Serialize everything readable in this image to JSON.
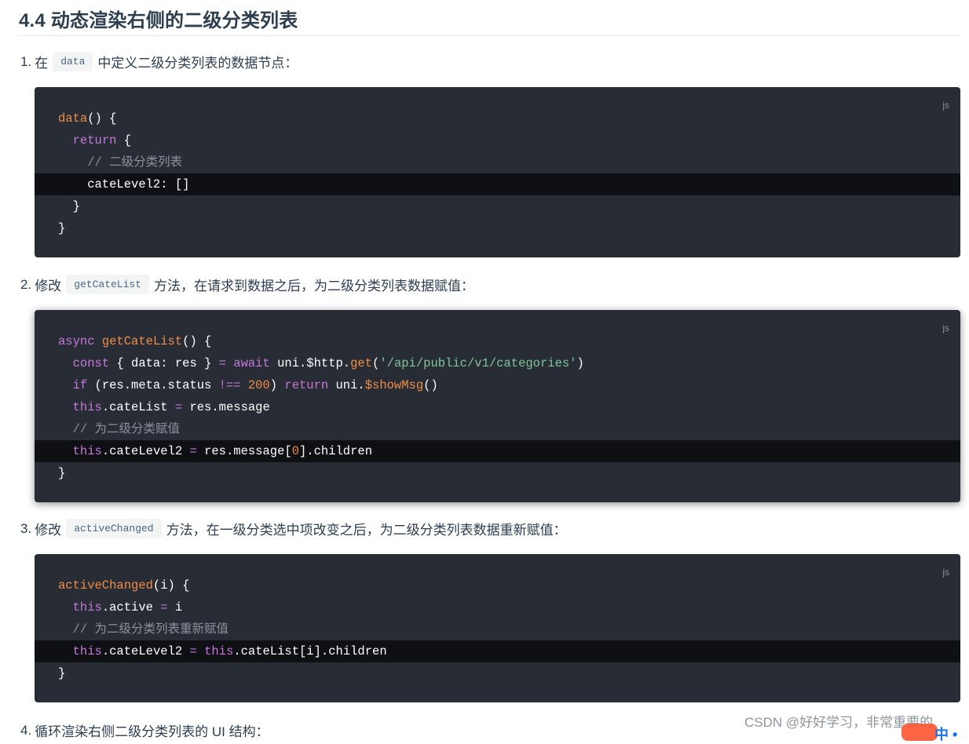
{
  "heading": "4.4 动态渲染右侧的二级分类列表",
  "steps": [
    {
      "num": "1.",
      "before": "在",
      "code": "data",
      "after": "中定义二级分类列表的数据节点："
    },
    {
      "num": "2.",
      "before": "修改",
      "code": "getCateList",
      "after": "方法，在请求到数据之后，为二级分类列表数据赋值："
    },
    {
      "num": "3.",
      "before": "修改",
      "code": "activeChanged",
      "after": "方法，在一级分类选中项改变之后，为二级分类列表数据重新赋值："
    },
    {
      "num": "4.",
      "text": "循环渲染右侧二级分类列表的 UI 结构："
    }
  ],
  "code_blocks": [
    {
      "lang": "js",
      "highlight_line": 4,
      "lines": [
        [
          {
            "t": "fn",
            "v": "data"
          },
          {
            "t": "pl",
            "v": "() {"
          }
        ],
        [
          {
            "t": "pl",
            "v": "  "
          },
          {
            "t": "kw",
            "v": "return"
          },
          {
            "t": "pl",
            "v": " {"
          }
        ],
        [
          {
            "t": "pl",
            "v": "    "
          },
          {
            "t": "cm",
            "v": "// 二级分类列表"
          }
        ],
        [
          {
            "t": "pl",
            "v": "    cateLevel2: []"
          }
        ],
        [
          {
            "t": "pl",
            "v": "  }"
          }
        ],
        [
          {
            "t": "pl",
            "v": "}"
          }
        ]
      ]
    },
    {
      "lang": "js",
      "highlight_line": 6,
      "lines": [
        [
          {
            "t": "kw",
            "v": "async"
          },
          {
            "t": "pl",
            "v": " "
          },
          {
            "t": "fn",
            "v": "getCateList"
          },
          {
            "t": "pl",
            "v": "() {"
          }
        ],
        [
          {
            "t": "pl",
            "v": "  "
          },
          {
            "t": "kw",
            "v": "const"
          },
          {
            "t": "pl",
            "v": " { data: res } "
          },
          {
            "t": "op",
            "v": "="
          },
          {
            "t": "pl",
            "v": " "
          },
          {
            "t": "kw",
            "v": "await"
          },
          {
            "t": "pl",
            "v": " uni.$http."
          },
          {
            "t": "fn",
            "v": "get"
          },
          {
            "t": "pl",
            "v": "("
          },
          {
            "t": "str",
            "v": "'/api/public/v1/categories'"
          },
          {
            "t": "pl",
            "v": ")"
          }
        ],
        [
          {
            "t": "pl",
            "v": "  "
          },
          {
            "t": "kw",
            "v": "if"
          },
          {
            "t": "pl",
            "v": " (res.meta.status "
          },
          {
            "t": "op",
            "v": "!=="
          },
          {
            "t": "pl",
            "v": " "
          },
          {
            "t": "num-t",
            "v": "200"
          },
          {
            "t": "pl",
            "v": ") "
          },
          {
            "t": "kw",
            "v": "return"
          },
          {
            "t": "pl",
            "v": " uni."
          },
          {
            "t": "fn",
            "v": "$showMsg"
          },
          {
            "t": "pl",
            "v": "()"
          }
        ],
        [
          {
            "t": "pl",
            "v": "  "
          },
          {
            "t": "kw",
            "v": "this"
          },
          {
            "t": "pl",
            "v": ".cateList "
          },
          {
            "t": "op",
            "v": "="
          },
          {
            "t": "pl",
            "v": " res.message"
          }
        ],
        [
          {
            "t": "pl",
            "v": "  "
          },
          {
            "t": "cm",
            "v": "// 为二级分类赋值"
          }
        ],
        [
          {
            "t": "pl",
            "v": "  "
          },
          {
            "t": "kw",
            "v": "this"
          },
          {
            "t": "pl",
            "v": ".cateLevel2 "
          },
          {
            "t": "op",
            "v": "="
          },
          {
            "t": "pl",
            "v": " res.message["
          },
          {
            "t": "num-t",
            "v": "0"
          },
          {
            "t": "pl",
            "v": "].children"
          }
        ],
        [
          {
            "t": "pl",
            "v": "}"
          }
        ]
      ]
    },
    {
      "lang": "js",
      "highlight_line": 4,
      "lines": [
        [
          {
            "t": "fn",
            "v": "activeChanged"
          },
          {
            "t": "pl",
            "v": "(i) {"
          }
        ],
        [
          {
            "t": "pl",
            "v": "  "
          },
          {
            "t": "kw",
            "v": "this"
          },
          {
            "t": "pl",
            "v": ".active "
          },
          {
            "t": "op",
            "v": "="
          },
          {
            "t": "pl",
            "v": " i"
          }
        ],
        [
          {
            "t": "pl",
            "v": "  "
          },
          {
            "t": "cm",
            "v": "// 为二级分类列表重新赋值"
          }
        ],
        [
          {
            "t": "pl",
            "v": "  "
          },
          {
            "t": "kw",
            "v": "this"
          },
          {
            "t": "pl",
            "v": ".cateLevel2 "
          },
          {
            "t": "op",
            "v": "="
          },
          {
            "t": "pl",
            "v": " "
          },
          {
            "t": "kw",
            "v": "this"
          },
          {
            "t": "pl",
            "v": ".cateList[i].children"
          }
        ],
        [
          {
            "t": "pl",
            "v": "}"
          }
        ]
      ]
    }
  ],
  "watermark": "CSDN @好好学习，非常重要的"
}
